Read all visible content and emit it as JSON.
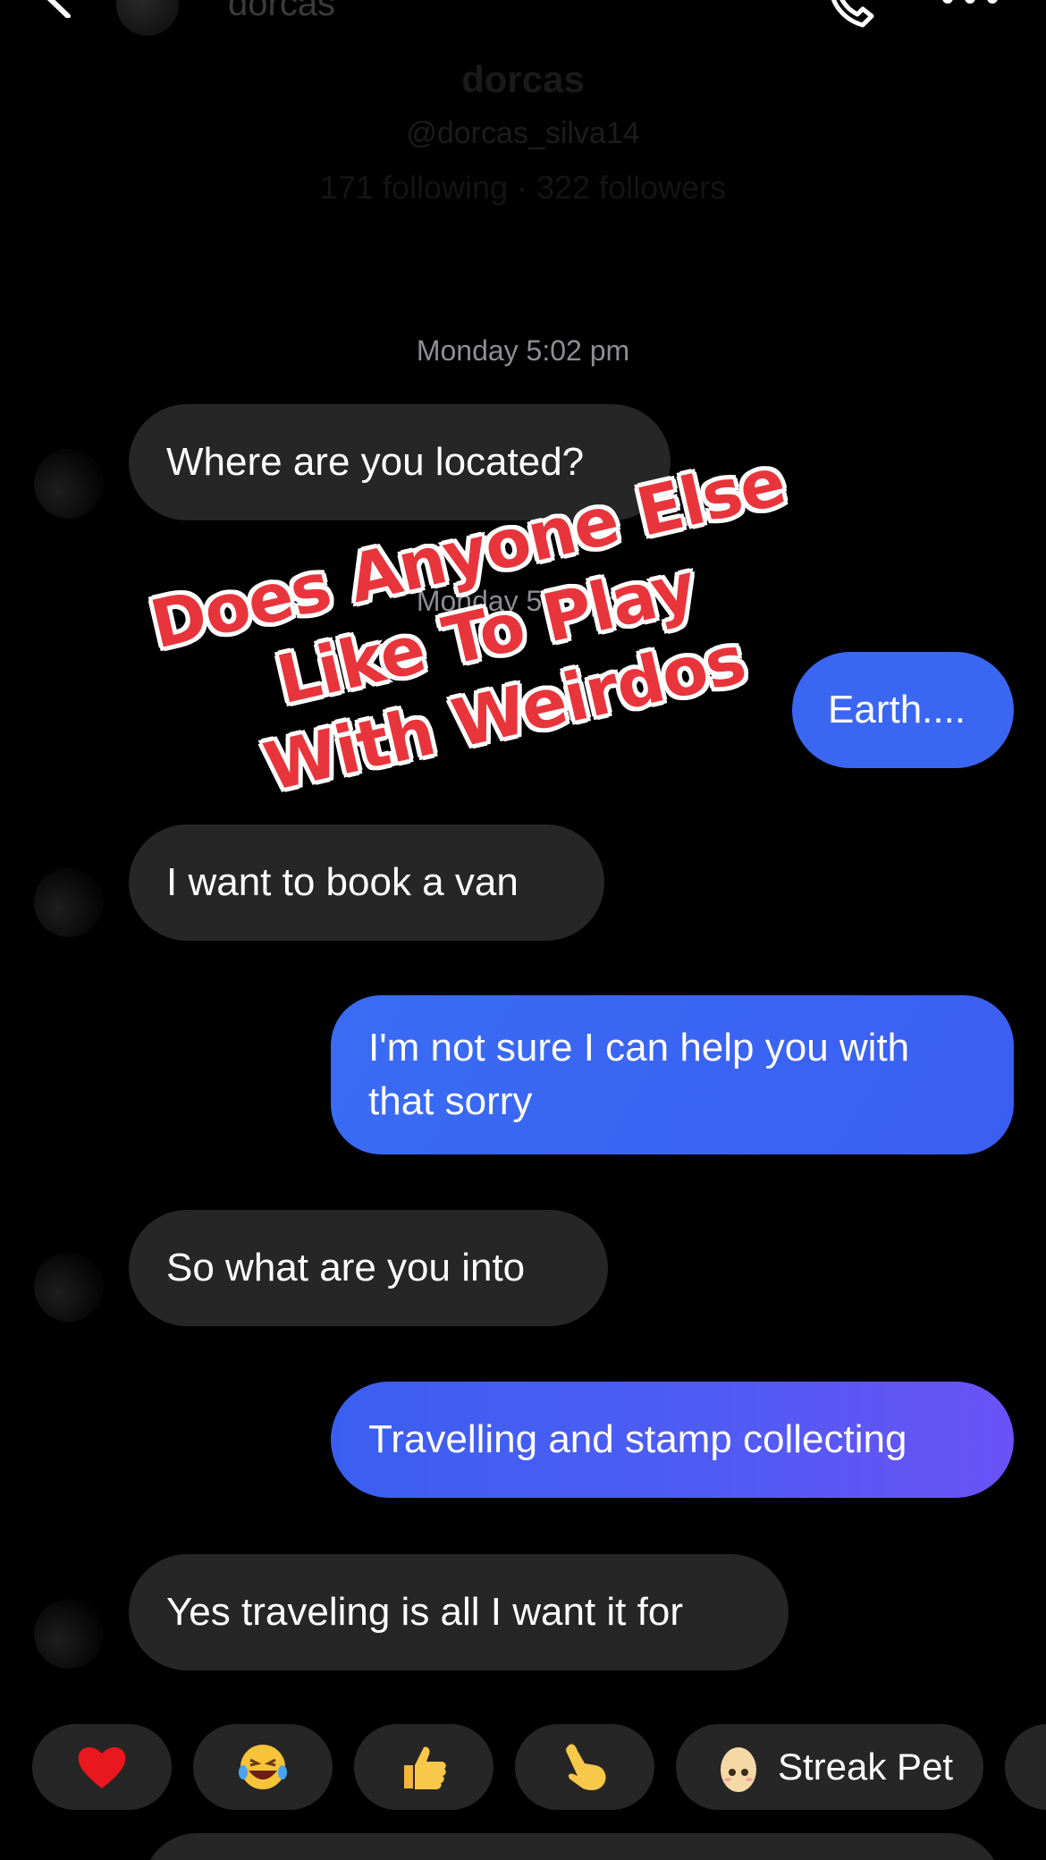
{
  "header": {
    "name": "dorcas",
    "profile_name": "dorcas",
    "handle": "@dorcas_silva14",
    "stats": "171 following · 322 followers"
  },
  "messages": [
    {
      "type": "timestamp",
      "text": "Monday 5:02 pm"
    },
    {
      "type": "incoming",
      "text": "Where are you located?"
    },
    {
      "type": "timestamp",
      "text": "Monday 5:19 pm"
    },
    {
      "type": "outgoing",
      "text": "Earth...."
    },
    {
      "type": "incoming",
      "text": "I want to book a van"
    },
    {
      "type": "outgoing",
      "text": "I'm not sure I can help you with that sorry"
    },
    {
      "type": "incoming",
      "text": "So what are you into"
    },
    {
      "type": "outgoing",
      "text": "Travelling and stamp collecting"
    },
    {
      "type": "incoming",
      "text": "Yes traveling is all I want it for"
    }
  ],
  "overlay": {
    "line1": "Does Anyone Else",
    "line2": "Like To Play",
    "line3": "With Weirdos"
  },
  "reactions": [
    {
      "icon": "heart-icon"
    },
    {
      "icon": "laughing-tears-icon"
    },
    {
      "icon": "thumbs-up-icon"
    },
    {
      "icon": "pointing-hand-icon"
    },
    {
      "icon": "egg-pet-icon",
      "label": "Streak Pet"
    }
  ],
  "colors": {
    "background": "#000000",
    "incoming_bubble": "#262626",
    "outgoing_bubble": "#3a66f2",
    "timestamp": "#8e8e93",
    "overlay_text": "#e8353c"
  }
}
